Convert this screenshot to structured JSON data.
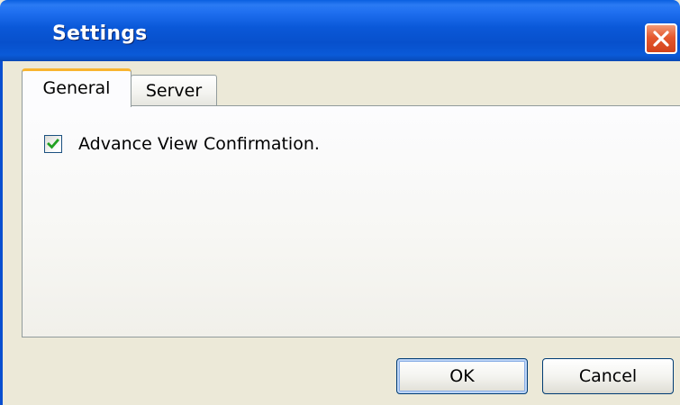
{
  "window": {
    "title": "Settings",
    "close_icon": "close-icon"
  },
  "tabs": [
    {
      "label": "General",
      "selected": true
    },
    {
      "label": "Server",
      "selected": false
    }
  ],
  "general": {
    "advance_view_confirmation": {
      "label": "Advance View Confirmation.",
      "checked": true
    }
  },
  "buttons": {
    "ok_label": "OK",
    "cancel_label": "Cancel"
  },
  "colors": {
    "titlebar": "#0a58d8",
    "close_button": "#e5582d",
    "dialog_background": "#ece9d8",
    "selected_tab_accent": "#f8b530",
    "checkmark": "#21a121"
  }
}
